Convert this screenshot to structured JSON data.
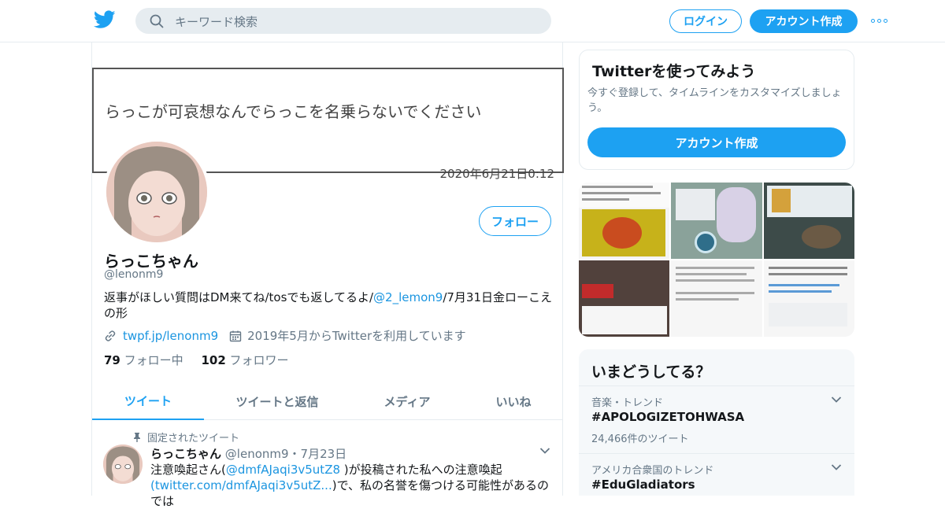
{
  "header": {
    "search_placeholder": "キーワード検索",
    "login_label": "ログイン",
    "signup_label": "アカウント作成"
  },
  "banner": {
    "text": "らっこが可哀想なんでらっこを名乗らないでください",
    "date": "2020年6月21日0:12"
  },
  "profile": {
    "follow_label": "フォロー",
    "name": "らっこちゃん",
    "handle": "@lenonm9",
    "bio_pre": "返事がほしい質問はDM来てね/tosでも返してるよ/",
    "bio_link": "@2_lemon9",
    "bio_post": "/7月31日金ローこえの形",
    "website": "twpf.jp/lenonm9",
    "joined": "2019年5月からTwitterを利用しています",
    "following_count": "79",
    "following_label": "フォロー中",
    "followers_count": "102",
    "followers_label": "フォロワー"
  },
  "tabs": [
    {
      "label": "ツイート"
    },
    {
      "label": "ツイートと返信"
    },
    {
      "label": "メディア"
    },
    {
      "label": "いいね"
    }
  ],
  "tweet": {
    "pinned_label": "固定されたツイート",
    "name": "らっこちゃん",
    "handle": "@lenonm9",
    "date": "・7月23日",
    "line1_pre": "注意喚起さん(",
    "line1_link": "@dmfAJaqi3v5utZ8",
    "line1_post": " )が投稿された私への注意喚起",
    "line2_link": "(twitter.com/dmfAJaqi3v5utZ...",
    "line2_post": ")で、私の名誉を傷つける可能性があるのでは"
  },
  "sidebar": {
    "try_title": "Twitterを使ってみよう",
    "try_desc": "今すぐ登録して、タイムラインをカスタマイズしましょう。",
    "try_button": "アカウント作成",
    "trends_title": "いまどうしてる？",
    "trends": [
      {
        "category": "音楽・トレンド",
        "title": "#APOLOGIZETOHWASA",
        "count": "24,466件のツイート"
      },
      {
        "category": "アメリカ合衆国のトレンド",
        "title": "#EduGladiators",
        "count": ""
      }
    ]
  },
  "colors": {
    "accent": "#1da1f2",
    "link": "#1b95e0",
    "muted": "#657786"
  }
}
